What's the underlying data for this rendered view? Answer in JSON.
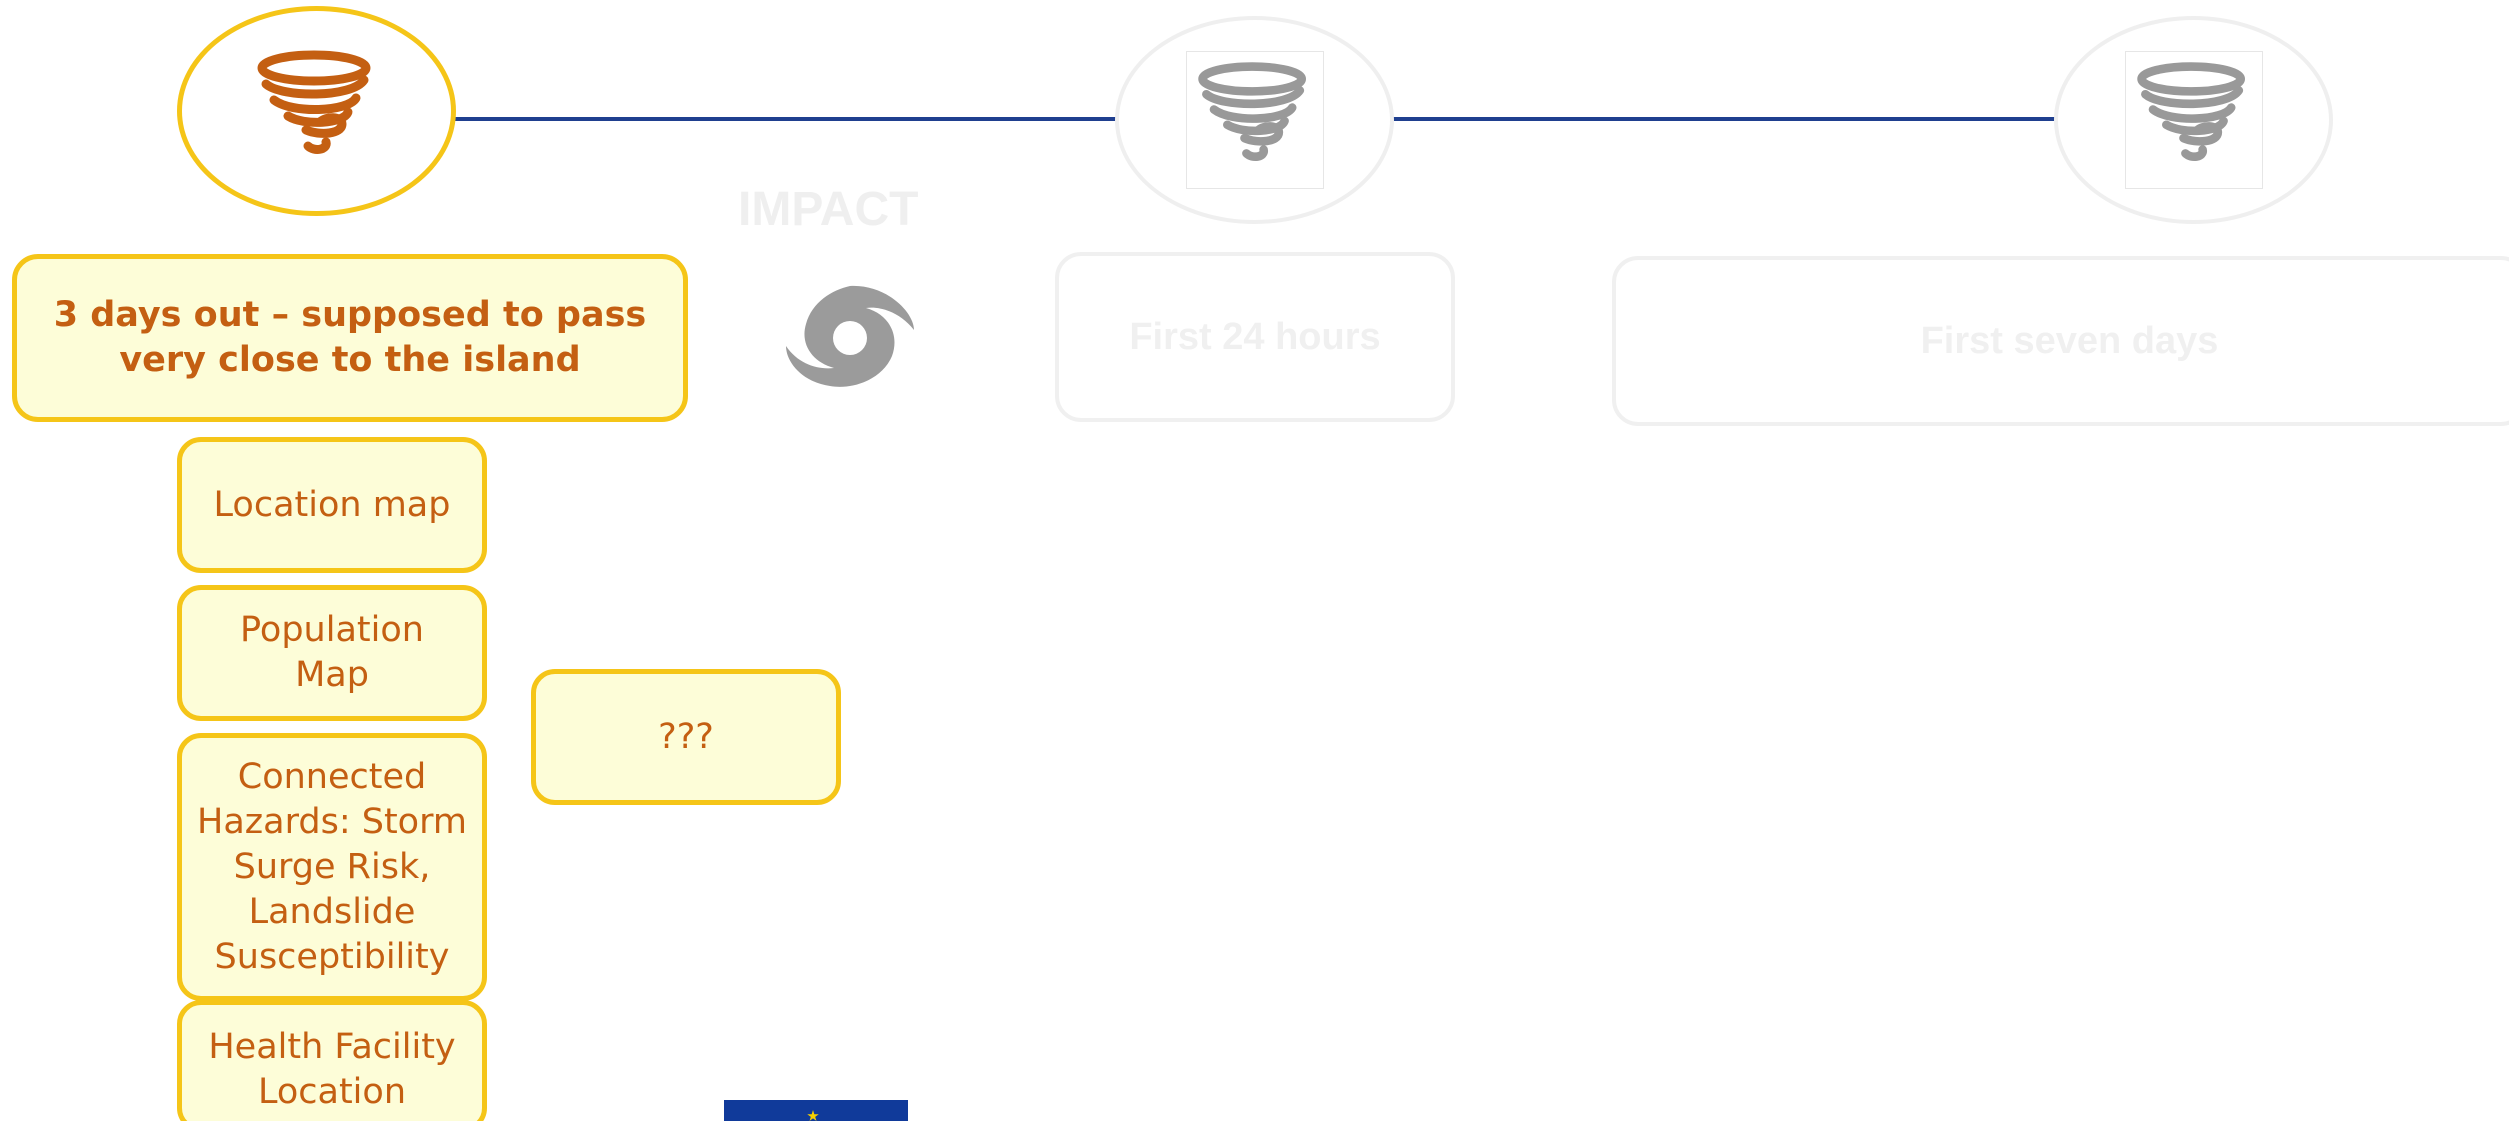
{
  "stages": [
    {
      "header": "3 days out – supposed to pass very close to the island",
      "icon": "tornado-icon",
      "state": "active"
    },
    {
      "header": "First 24 hours",
      "icon": "tornado-icon",
      "state": "inactive"
    },
    {
      "header": "First seven days",
      "icon": "tornado-icon",
      "state": "inactive"
    }
  ],
  "impact_label": "IMPACT",
  "products": [
    {
      "label": "Location map"
    },
    {
      "label": "Population Map"
    },
    {
      "label": "Connected Hazards: Storm Surge Risk, Landslide Susceptibility"
    },
    {
      "label": "Health Facility Location"
    }
  ],
  "unknown_card": {
    "label": "???"
  },
  "colors": {
    "accent_border": "#f5c518",
    "card_fill": "#fdfdd8",
    "text_orange": "#c45f12",
    "timeline_blue": "#1f3f8f",
    "inactive_gray": "#f0f0f0",
    "icon_gray": "#999999"
  }
}
